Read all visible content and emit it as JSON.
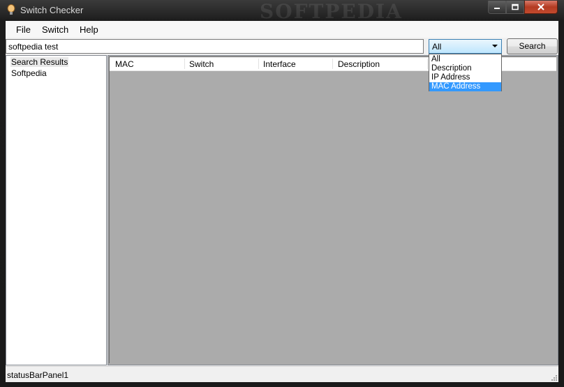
{
  "window": {
    "title": "Switch Checker",
    "watermark": "SOFTPEDIA"
  },
  "menu": [
    "File",
    "Switch",
    "Help"
  ],
  "search": {
    "value": "softpedia test",
    "button_label": "Search"
  },
  "filter": {
    "selected": "All",
    "options": [
      "All",
      "Description",
      "IP Address",
      "MAC Address"
    ],
    "highlighted_option": "MAC Address"
  },
  "tree": {
    "nodes": [
      "Search Results",
      "Softpedia"
    ],
    "selected": "Search Results"
  },
  "table": {
    "columns": [
      "MAC",
      "Switch",
      "Interface",
      "Description"
    ],
    "rows": []
  },
  "status": {
    "panel_text": "statusBarPanel1"
  },
  "colors": {
    "selection": "#3399ff",
    "list_background": "#ababab",
    "close_button": "#c24a2e"
  }
}
